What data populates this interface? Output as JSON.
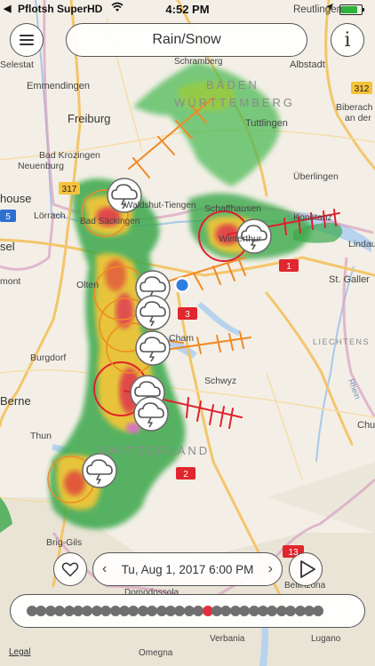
{
  "status_bar": {
    "back_label": "◀",
    "carrier": "Pflotsh SuperHD",
    "wifi_icon": "wifi-icon",
    "time": "4:52 PM",
    "location_icon": "location-arrow-icon",
    "battery_level": 0.9
  },
  "header": {
    "menu_icon": "hamburger-menu-icon",
    "layer_label": "Rain/Snow",
    "info_label": "i"
  },
  "map_labels": {
    "reutlingen": "Reutlingen",
    "selestat": "Selestat",
    "schramberg": "Schramberg",
    "albstadt": "Albstadt",
    "emmendingen": "Emmendingen",
    "baden": "BADEN",
    "wurttemberg": "WÜRTTEMBERG",
    "freiburg": "Freiburg",
    "biberach": "Biberach",
    "an_der": "an der",
    "tuttlingen": "Tuttlingen",
    "bad_krozingen": "Bad Krozingen",
    "neuenburg": "Neuenburg",
    "uberlingen": "Überlingen",
    "mulhouse": "house",
    "lorrach": "Lörrach",
    "schaffhausen": "Schaffhausen",
    "konstanz": "Konstanz",
    "waldshut": "Waldshut-Tiengen",
    "bad_sackingen": "Bad Säckingen",
    "basel": "sel",
    "winterthur": "Winterthur",
    "lindau": "Lindau",
    "olten": "Olten",
    "st_gallen": "St. Galler",
    "mont": "mont",
    "cham": "Cham",
    "liechtenstein": "LIECHTENS",
    "burgdorf": "Burgdorf",
    "schwyz": "Schwyz",
    "rhein": "Rhein",
    "bern": "Berne",
    "chur": "Chur",
    "thun": "Thun",
    "switzerland": "SWITZERLAND",
    "brig": "Brig-Gils",
    "domodossola": "Domodossola",
    "bellinzona": "Bellinzona",
    "omegna": "Omegna",
    "verbania": "Verbania",
    "lugano": "Lugano"
  },
  "road_shields": [
    "312",
    "317",
    "5",
    "1",
    "3",
    "2",
    "13"
  ],
  "storm_cell_icon": "thundercloud-icon",
  "playback": {
    "favorite_icon": "heart-icon",
    "prev_label": "‹",
    "date_label": "Tu, Aug 1, 2017 6:00 PM",
    "next_label": "›",
    "play_icon": "play-icon"
  },
  "timeline": {
    "frame_count": 32,
    "current_frame_index": 19
  },
  "legal_label": "Legal",
  "colors": {
    "radar_light": "#2aa84a",
    "radar_mid": "#e7c43a",
    "radar_heavy": "#e04a4a",
    "storm_track_orange": "#f08a24",
    "storm_track_red": "#e0202e",
    "timeline_active": "#e03040"
  }
}
